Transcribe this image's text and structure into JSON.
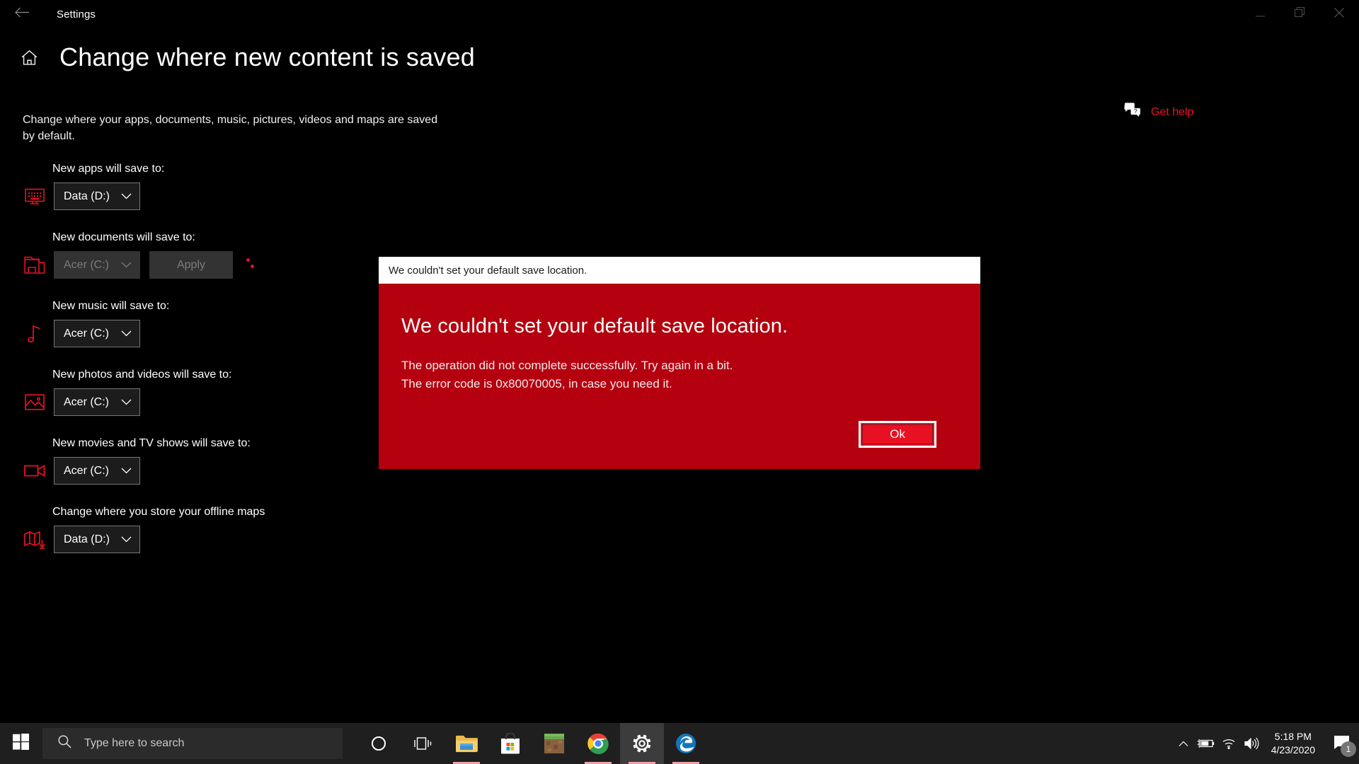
{
  "window": {
    "app_title": "Settings",
    "back_icon": "back-arrow-icon",
    "minimize_label": "Minimize",
    "restore_label": "Restore",
    "close_label": "Close"
  },
  "page": {
    "home_icon": "home-icon",
    "title": "Change where new content is saved",
    "intro": "Change where your apps, documents, music, pictures, videos and maps are saved by default."
  },
  "get_help": {
    "label": "Get help",
    "icon": "help-chat-icon",
    "color": "#e81123"
  },
  "settings": [
    {
      "label": "New apps will save to:",
      "icon": "monitor-apps-icon",
      "value": "Data (D:)",
      "disabled": false,
      "has_apply": false,
      "has_spinner": false
    },
    {
      "label": "New documents will save to:",
      "icon": "documents-folder-icon",
      "value": "Acer (C:)",
      "disabled": true,
      "has_apply": true,
      "apply_label": "Apply",
      "has_spinner": true
    },
    {
      "label": "New music will save to:",
      "icon": "music-note-icon",
      "value": "Acer (C:)",
      "disabled": false,
      "has_apply": false,
      "has_spinner": false
    },
    {
      "label": "New photos and videos will save to:",
      "icon": "photo-image-icon",
      "value": "Acer (C:)",
      "disabled": false,
      "has_apply": false,
      "has_spinner": false
    },
    {
      "label": "New movies and TV shows will save to:",
      "icon": "video-camera-icon",
      "value": "Acer (C:)",
      "disabled": false,
      "has_apply": false,
      "has_spinner": false
    },
    {
      "label": "Change where you store your offline maps",
      "icon": "map-download-icon",
      "value": "Data (D:)",
      "disabled": false,
      "has_apply": false,
      "has_spinner": false
    }
  ],
  "dialog": {
    "titlebar_text": "We couldn't set your default save location.",
    "heading": "We couldn't set your default save location.",
    "line1": "The operation did not complete successfully. Try again in a bit.",
    "line2": "The error code is 0x80070005, in case you need it.",
    "error_code": "0x80070005",
    "ok_label": "Ok",
    "body_color": "#b4000f",
    "button_color": "#e81123"
  },
  "taskbar": {
    "start_icon": "windows-start-icon",
    "search_placeholder": "Type here to search",
    "search_icon": "search-icon",
    "apps": [
      {
        "name": "cortana-icon",
        "active": false,
        "running": false
      },
      {
        "name": "task-view-icon",
        "active": false,
        "running": false
      },
      {
        "name": "file-explorer-icon",
        "active": false,
        "running": true
      },
      {
        "name": "microsoft-store-icon",
        "active": false,
        "running": false
      },
      {
        "name": "minecraft-icon",
        "active": false,
        "running": false
      },
      {
        "name": "chrome-icon",
        "active": false,
        "running": true
      },
      {
        "name": "settings-icon",
        "active": true,
        "running": true
      },
      {
        "name": "edge-icon",
        "active": false,
        "running": true
      }
    ],
    "tray": {
      "chevron_icon": "chevron-up-icon",
      "battery_icon": "battery-charging-icon",
      "wifi_icon": "wifi-icon",
      "volume_icon": "volume-icon",
      "time": "5:18 PM",
      "date": "4/23/2020",
      "notification_icon": "notification-icon",
      "notification_count": "1"
    }
  }
}
